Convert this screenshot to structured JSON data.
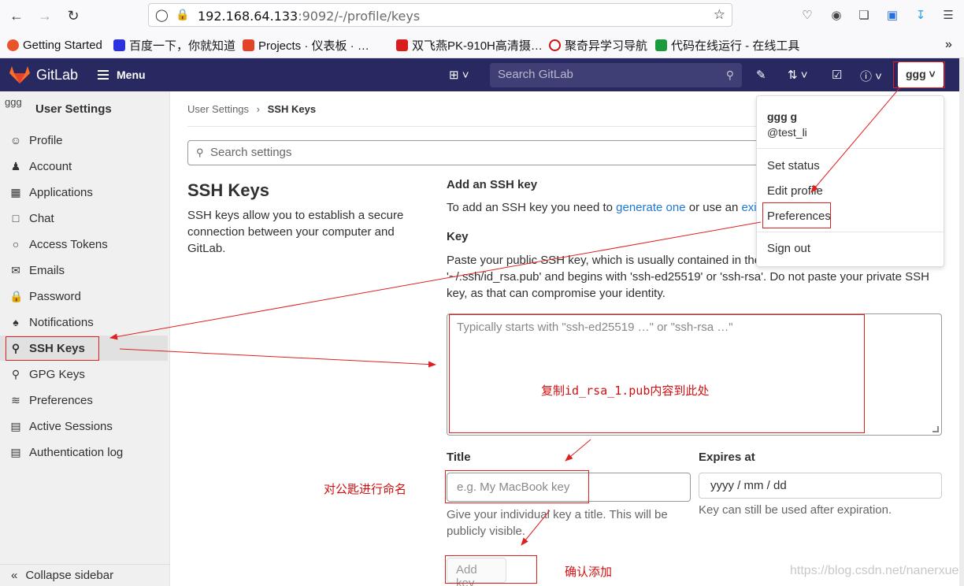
{
  "browser": {
    "url_host": "192.168.64.133",
    "url_path": ":9092/-/profile/keys",
    "bookmarks": [
      "Getting Started",
      "百度一下，你就知道",
      "Projects · 仪表板 · …",
      "双飞燕PK-910H高清摄…",
      "聚奇异学习导航",
      "代码在线运行 - 在线工具"
    ]
  },
  "header": {
    "brand": "GitLab",
    "menu_label": "Menu",
    "search_placeholder": "Search GitLab",
    "user_short": "ggg"
  },
  "sidebar": {
    "avatar_text": "ggg",
    "title": "User Settings",
    "items": [
      {
        "label": "Profile",
        "icon": "profile-icon"
      },
      {
        "label": "Account",
        "icon": "account-icon"
      },
      {
        "label": "Applications",
        "icon": "applications-icon"
      },
      {
        "label": "Chat",
        "icon": "chat-icon"
      },
      {
        "label": "Access Tokens",
        "icon": "token-icon"
      },
      {
        "label": "Emails",
        "icon": "mail-icon"
      },
      {
        "label": "Password",
        "icon": "lock-icon"
      },
      {
        "label": "Notifications",
        "icon": "bell-icon"
      },
      {
        "label": "SSH Keys",
        "icon": "key-icon"
      },
      {
        "label": "GPG Keys",
        "icon": "key-icon"
      },
      {
        "label": "Preferences",
        "icon": "preferences-icon"
      },
      {
        "label": "Active Sessions",
        "icon": "monitor-icon"
      },
      {
        "label": "Authentication log",
        "icon": "log-icon"
      }
    ],
    "collapse_label": "Collapse sidebar"
  },
  "breadcrumb": {
    "parent": "User Settings",
    "current": "SSH Keys"
  },
  "settings_search_placeholder": "Search settings",
  "main": {
    "title": "SSH Keys",
    "description": "SSH keys allow you to establish a secure connection between your computer and GitLab.",
    "add_heading": "Add an SSH key",
    "add_sub_prefix": "To add an SSH key you need to ",
    "add_sub_link1": "generate one",
    "add_sub_middle": " or use an ",
    "add_sub_link2": "existi",
    "key_label": "Key",
    "key_help": "Paste your public SSH key, which is usually contained in the f",
    "key_help_2": "'~/.ssh/id_rsa.pub' and begins with 'ssh-ed25519' or 'ssh-rsa'. Do not paste your private SSH key, as that can compromise your identity.",
    "key_placeholder": "Typically starts with \"ssh-ed25519 …\" or \"ssh-rsa …\"",
    "title_label": "Title",
    "title_placeholder": "e.g. My MacBook key",
    "title_help": "Give your individual key a title. This will be publicly visible.",
    "expires_label": "Expires at",
    "expires_value": "yyyy / mm / dd",
    "expires_help": "Key can still be used after expiration.",
    "add_button": "Add key"
  },
  "dropdown": {
    "name": "ggg g",
    "handle": "@test_li",
    "items": [
      "Set status",
      "Edit profile",
      "Preferences",
      "Sign out"
    ]
  },
  "annotations": {
    "copy_hint": "复制id_rsa_1.pub内容到此处",
    "name_hint": "对公匙进行命名",
    "confirm_hint": "确认添加"
  },
  "watermark": "https://blog.csdn.net/nanerxue",
  "colors": {
    "header_bg": "#292961",
    "link": "#1f78d1",
    "annotation_red": "#e02020"
  }
}
